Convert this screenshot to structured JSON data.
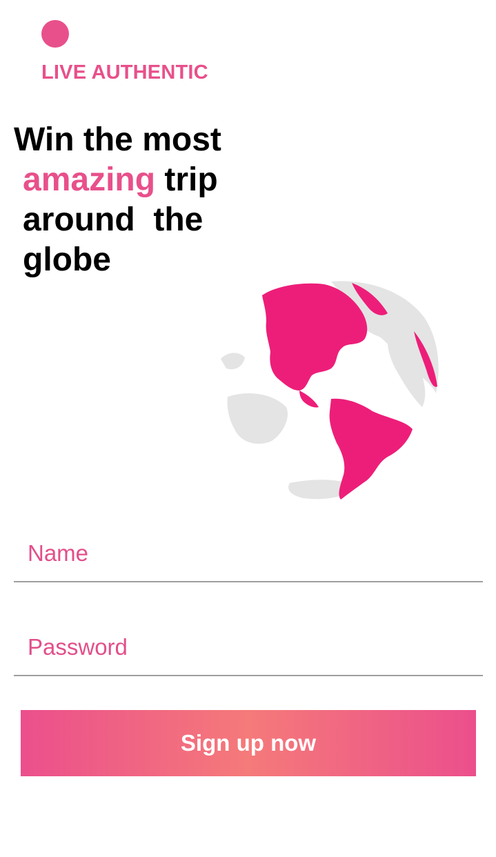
{
  "brand": {
    "name": "LIVE AUTHENTIC",
    "color": "#e8508b"
  },
  "headline": {
    "line1": "Win the most",
    "accent_word": "amazing",
    "line2_rest": " trip",
    "line3": "around  the",
    "line4": "globe",
    "accent_color": "#e8508b"
  },
  "illustration": {
    "icon": "globe-icon",
    "land_highlight_color": "#ed1e79",
    "land_other_color": "#e4e4e4"
  },
  "form": {
    "name_placeholder": "Name",
    "password_placeholder": "Password",
    "submit_label": "Sign up now"
  }
}
